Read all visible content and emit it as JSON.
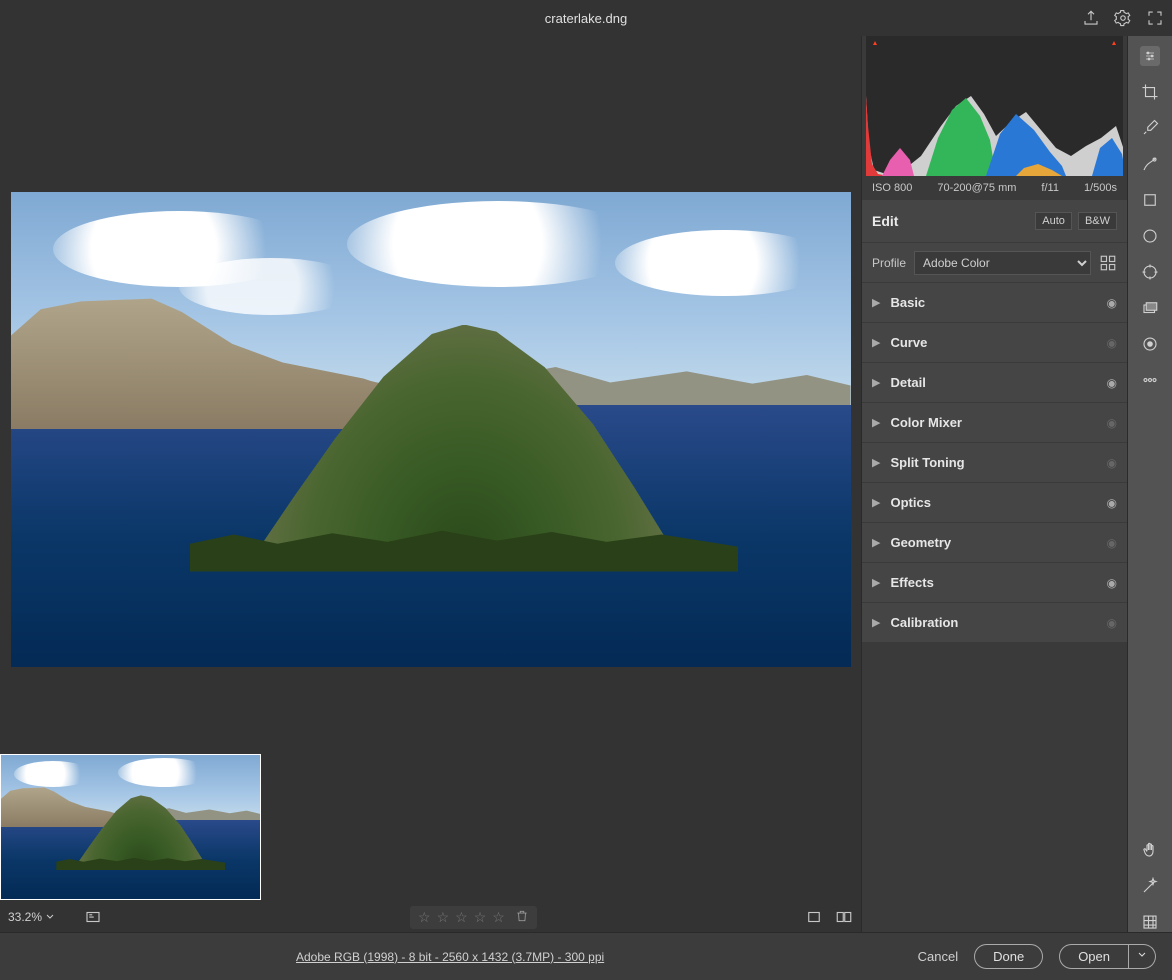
{
  "title": "craterlake.dng",
  "zoom": "33.2%",
  "metadata": {
    "iso": "ISO 800",
    "lens": "70-200@75 mm",
    "aperture": "f/11",
    "shutter": "1/500s"
  },
  "edit": {
    "title": "Edit",
    "auto": "Auto",
    "bw": "B&W"
  },
  "profile": {
    "label": "Profile",
    "value": "Adobe Color"
  },
  "panels": [
    {
      "name": "Basic",
      "eye": true
    },
    {
      "name": "Curve",
      "eye": false
    },
    {
      "name": "Detail",
      "eye": true
    },
    {
      "name": "Color Mixer",
      "eye": false
    },
    {
      "name": "Split Toning",
      "eye": false
    },
    {
      "name": "Optics",
      "eye": true
    },
    {
      "name": "Geometry",
      "eye": false
    },
    {
      "name": "Effects",
      "eye": true
    },
    {
      "name": "Calibration",
      "eye": false
    }
  ],
  "bottom": {
    "info": "Adobe RGB (1998) - 8 bit - 2560 x 1432 (3.7MP) - 300 ppi",
    "cancel": "Cancel",
    "done": "Done",
    "open": "Open"
  }
}
